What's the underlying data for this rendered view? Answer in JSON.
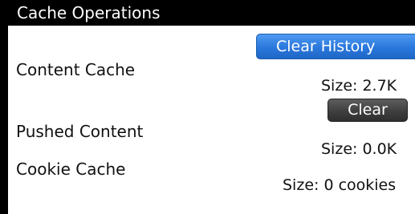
{
  "screen": {
    "title": "Cache Operations"
  },
  "actions": {
    "clear_history_label": "Clear History"
  },
  "sections": {
    "content_cache": {
      "label": "Content Cache",
      "size": "Size: 2.7K",
      "clear_label": "Clear"
    },
    "pushed_content": {
      "label": "Pushed Content",
      "size": "Size: 0.0K"
    },
    "cookie_cache": {
      "label": "Cookie Cache",
      "size": "Size: 0 cookies"
    }
  },
  "colors": {
    "title_bar": "#000000",
    "primary_button": "#2a78dd",
    "secondary_button": "#3f3f3f",
    "text": "#111111"
  }
}
